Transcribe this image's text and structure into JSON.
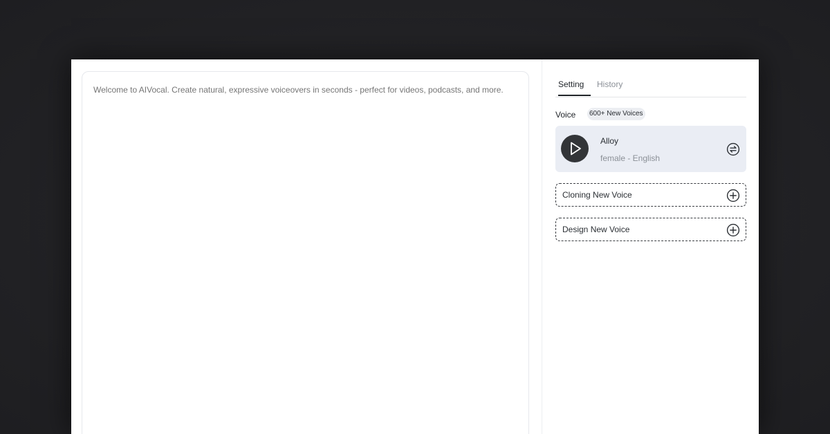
{
  "editor": {
    "placeholder": "Welcome to AIVocal. Create natural, expressive voiceovers in seconds - perfect for videos, podcasts, and more."
  },
  "tabs": [
    {
      "label": "Setting",
      "active": true
    },
    {
      "label": "History",
      "active": false
    }
  ],
  "voice": {
    "label": "Voice",
    "badge": "600+ New Voices",
    "selected": {
      "name": "Alloy",
      "meta": "female - English"
    }
  },
  "actions": {
    "cloning_label": "Cloning New Voice",
    "design_label": "Design New Voice"
  },
  "icons": {
    "play": "play-icon",
    "swap": "swap-icon",
    "add": "plus-circle-icon"
  },
  "colors": {
    "page_bg": "#222225",
    "panel_bg": "#ffffff",
    "voice_card_bg": "#eaedf4",
    "badge_bg": "#eceef2",
    "play_button_bg": "#333538",
    "text_primary": "#1f2328",
    "text_muted": "#8a8f96",
    "placeholder": "#9aa0a6"
  }
}
